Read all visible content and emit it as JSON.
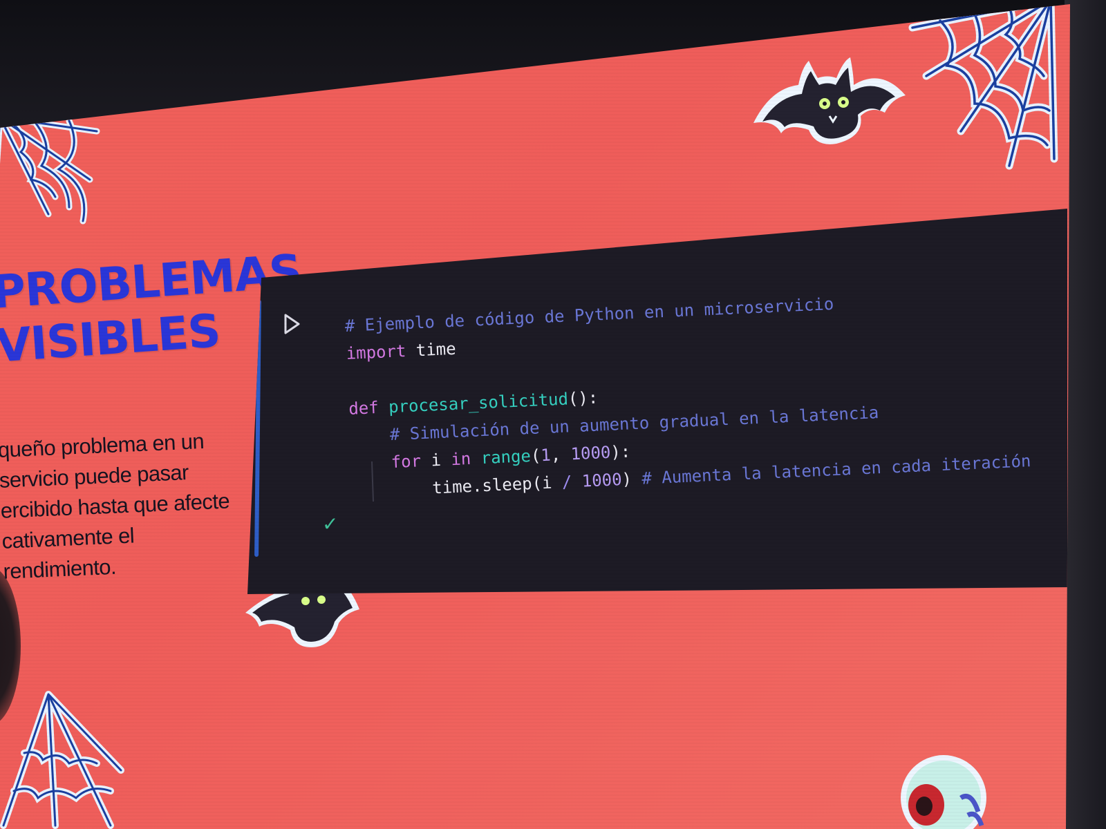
{
  "slide": {
    "heading_line1": "PROBLEMAS",
    "heading_line2": "VISIBLES",
    "body_lines": [
      "queño problema en un",
      "servicio puede pasar",
      "ercibido hasta que afecte",
      "cativamente el rendimiento."
    ]
  },
  "code_cell": {
    "run_icon": "play-icon",
    "status_icon": "checkmark-icon",
    "lines": {
      "l1_comment": "# Ejemplo de código de Python en un microservicio",
      "l2_kw": "import",
      "l2_mod": "time",
      "l4_kw": "def",
      "l4_fn": "procesar_solicitud",
      "l4_punct": "():",
      "l5_comment": "# Simulación de un aumento gradual en la latencia",
      "l6_for": "for",
      "l6_var": "i",
      "l6_in": "in",
      "l6_range": "range",
      "l6_open": "(",
      "l6_n1": "1",
      "l6_comma": ", ",
      "l6_n2": "1000",
      "l6_close": "):",
      "l7_call": "time.sleep(i",
      "l7_op": "/",
      "l7_n": "1000",
      "l7_close": ")",
      "l7_comment": "# Aumenta la latencia en cada iteración"
    }
  },
  "decorations": [
    "spider-web-icon",
    "bat-icon",
    "eyeball-icon"
  ],
  "colors": {
    "slide_background": "#ef5d5a",
    "heading": "#2a36d8",
    "code_background": "#1d1b25",
    "cell_bar": "#2e5ec7",
    "comment": "#6a77d6",
    "keyword": "#d479e3",
    "function": "#35d0c0",
    "number": "#b79cf4",
    "check": "#3fc29a"
  }
}
